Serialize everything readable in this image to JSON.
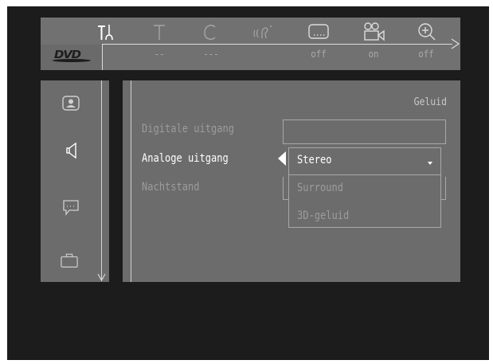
{
  "topbar": {
    "logo": "DVD",
    "items": [
      {
        "icon": "settings-tools-icon",
        "value": ""
      },
      {
        "icon": "title-icon",
        "value": "--"
      },
      {
        "icon": "chapter-icon",
        "value": "---"
      },
      {
        "icon": "audio-language-icon",
        "value": ""
      },
      {
        "icon": "subtitles-icon",
        "value": "off"
      },
      {
        "icon": "camera-angle-icon",
        "value": "on"
      },
      {
        "icon": "zoom-icon",
        "value": "off"
      }
    ]
  },
  "sidebar": {
    "items": [
      {
        "icon": "personal-preferences-icon"
      },
      {
        "icon": "speaker-audio-icon"
      },
      {
        "icon": "speech-bubble-icon"
      },
      {
        "icon": "briefcase-icon"
      }
    ]
  },
  "panel": {
    "title": "Geluid",
    "options": [
      {
        "label": "Digitale uitgang"
      },
      {
        "label": "Analoge uitgang"
      },
      {
        "label": "Nachtstand"
      }
    ]
  },
  "dropdown": {
    "items": [
      "Stereo",
      "Surround",
      "3D-geluid"
    ],
    "selected": "Stereo"
  },
  "colors": {
    "screen_bg": "#1c1c1c",
    "panel_bg": "#6c6c6c",
    "active_text": "#ffffff",
    "dim_text": "#9c9c9c"
  }
}
